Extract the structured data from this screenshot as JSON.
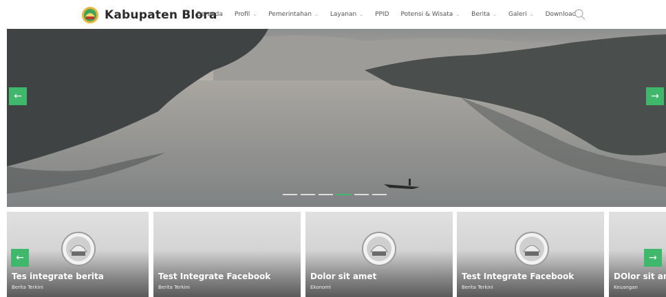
{
  "brand": {
    "name": "Kabupaten Blora"
  },
  "nav": {
    "items": [
      {
        "label": "Beranda",
        "dropdown": false
      },
      {
        "label": "Profil",
        "dropdown": true
      },
      {
        "label": "Pemerintahan",
        "dropdown": true
      },
      {
        "label": "Layanan",
        "dropdown": true
      },
      {
        "label": "PPID",
        "dropdown": false
      },
      {
        "label": "Potensi & Wisata",
        "dropdown": true
      },
      {
        "label": "Berita",
        "dropdown": true
      },
      {
        "label": "Galeri",
        "dropdown": true
      },
      {
        "label": "Download",
        "dropdown": false
      }
    ],
    "chevron": "⌄"
  },
  "icons": {
    "search": "search-icon",
    "arrow_left": "←",
    "arrow_right": "→"
  },
  "colors": {
    "accent": "#3fb86b",
    "text": "#2b2b2b"
  },
  "slider": {
    "count": 6,
    "active": 4
  },
  "cards": [
    {
      "title": "Tes integrate berita",
      "category": "Berita Terkini",
      "emblem": true
    },
    {
      "title": "Test Integrate Facebook",
      "category": "Berita Terkini",
      "emblem": false
    },
    {
      "title": "Dolor sit amet",
      "category": "Ekonomi",
      "emblem": true
    },
    {
      "title": "Test Integrate Facebook",
      "category": "Berita Terkini",
      "emblem": true
    },
    {
      "title": "DOlor sit amet",
      "category": "Keuangan",
      "emblem": false
    }
  ]
}
